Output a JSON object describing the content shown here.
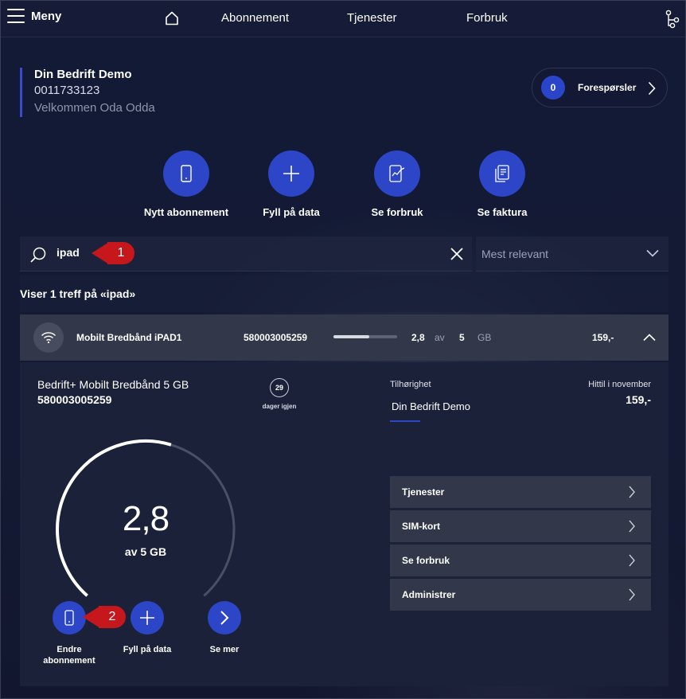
{
  "nav": {
    "menu_label": "Meny",
    "links": [
      "Abonnement",
      "Tjenester",
      "Forbruk"
    ]
  },
  "company": {
    "name": "Din Bedrift Demo",
    "number": "0011733123",
    "welcome": "Velkommen Oda Odda"
  },
  "requests": {
    "count": "0",
    "label": "Forespørsler"
  },
  "quick_actions": [
    {
      "label": "Nytt abonnement",
      "icon": "phone-icon"
    },
    {
      "label": "Fyll på data",
      "icon": "plus-icon"
    },
    {
      "label": "Se forbruk",
      "icon": "usage-chart-icon"
    },
    {
      "label": "Se faktura",
      "icon": "invoice-icon"
    }
  ],
  "search": {
    "value": "ipad",
    "placeholder": ""
  },
  "sort": {
    "selected": "Mest relevant"
  },
  "annotations": {
    "one": "1",
    "two": "2"
  },
  "results": {
    "summary": "Viser 1 treff på «ipad»"
  },
  "subscription": {
    "name": "Mobilt Bredbånd iPAD1",
    "number": "580003005259",
    "used": "2,8",
    "of_label": "av",
    "total": "5",
    "unit": "GB",
    "price": "159,-",
    "usage_fraction": 0.56
  },
  "detail": {
    "plan_name": "Bedrift+ Mobilt Bredbånd 5 GB",
    "plan_number": "580003005259",
    "days_left": "29",
    "days_label": "dager igjen",
    "belonging_label": "Tilhørighet",
    "belonging_value": "Din Bedrift Demo",
    "period_label": "Hittil i november",
    "period_value": "159,-",
    "gauge_value": "2,8",
    "gauge_sub": "av 5 GB",
    "actions": [
      {
        "label_line1": "Endre",
        "label_line2": "abonnement"
      },
      {
        "label_line1": "Fyll på data",
        "label_line2": ""
      },
      {
        "label_line1": "Se mer",
        "label_line2": ""
      }
    ],
    "links": [
      "Tjenester",
      "SIM-kort",
      "Se forbruk",
      "Administrer"
    ]
  },
  "colors": {
    "accent": "#2c46c7",
    "badge": "#c5171c",
    "background": "#131a36",
    "row": "#323849"
  }
}
